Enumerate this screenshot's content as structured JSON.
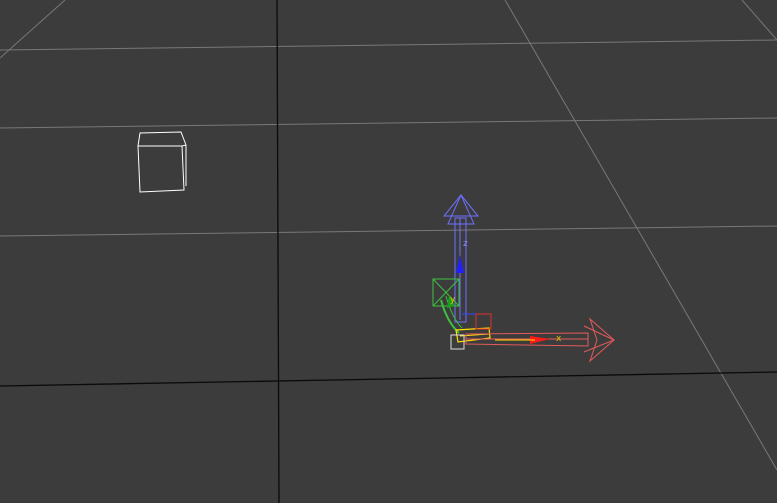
{
  "viewport": {
    "colors": {
      "background": "#3c3c3c",
      "grid_minor": "#7a7a7a",
      "grid_major": "#000000",
      "object_wire": "#ffffff",
      "axis_x": "#e35a5a",
      "axis_y": "#3fbf3f",
      "axis_z": "#6f6fff",
      "plane_highlight": "#ffe000"
    }
  },
  "gizmo": {
    "axis_x_label": "x",
    "axis_y_label": "y",
    "axis_z_label": "z"
  }
}
